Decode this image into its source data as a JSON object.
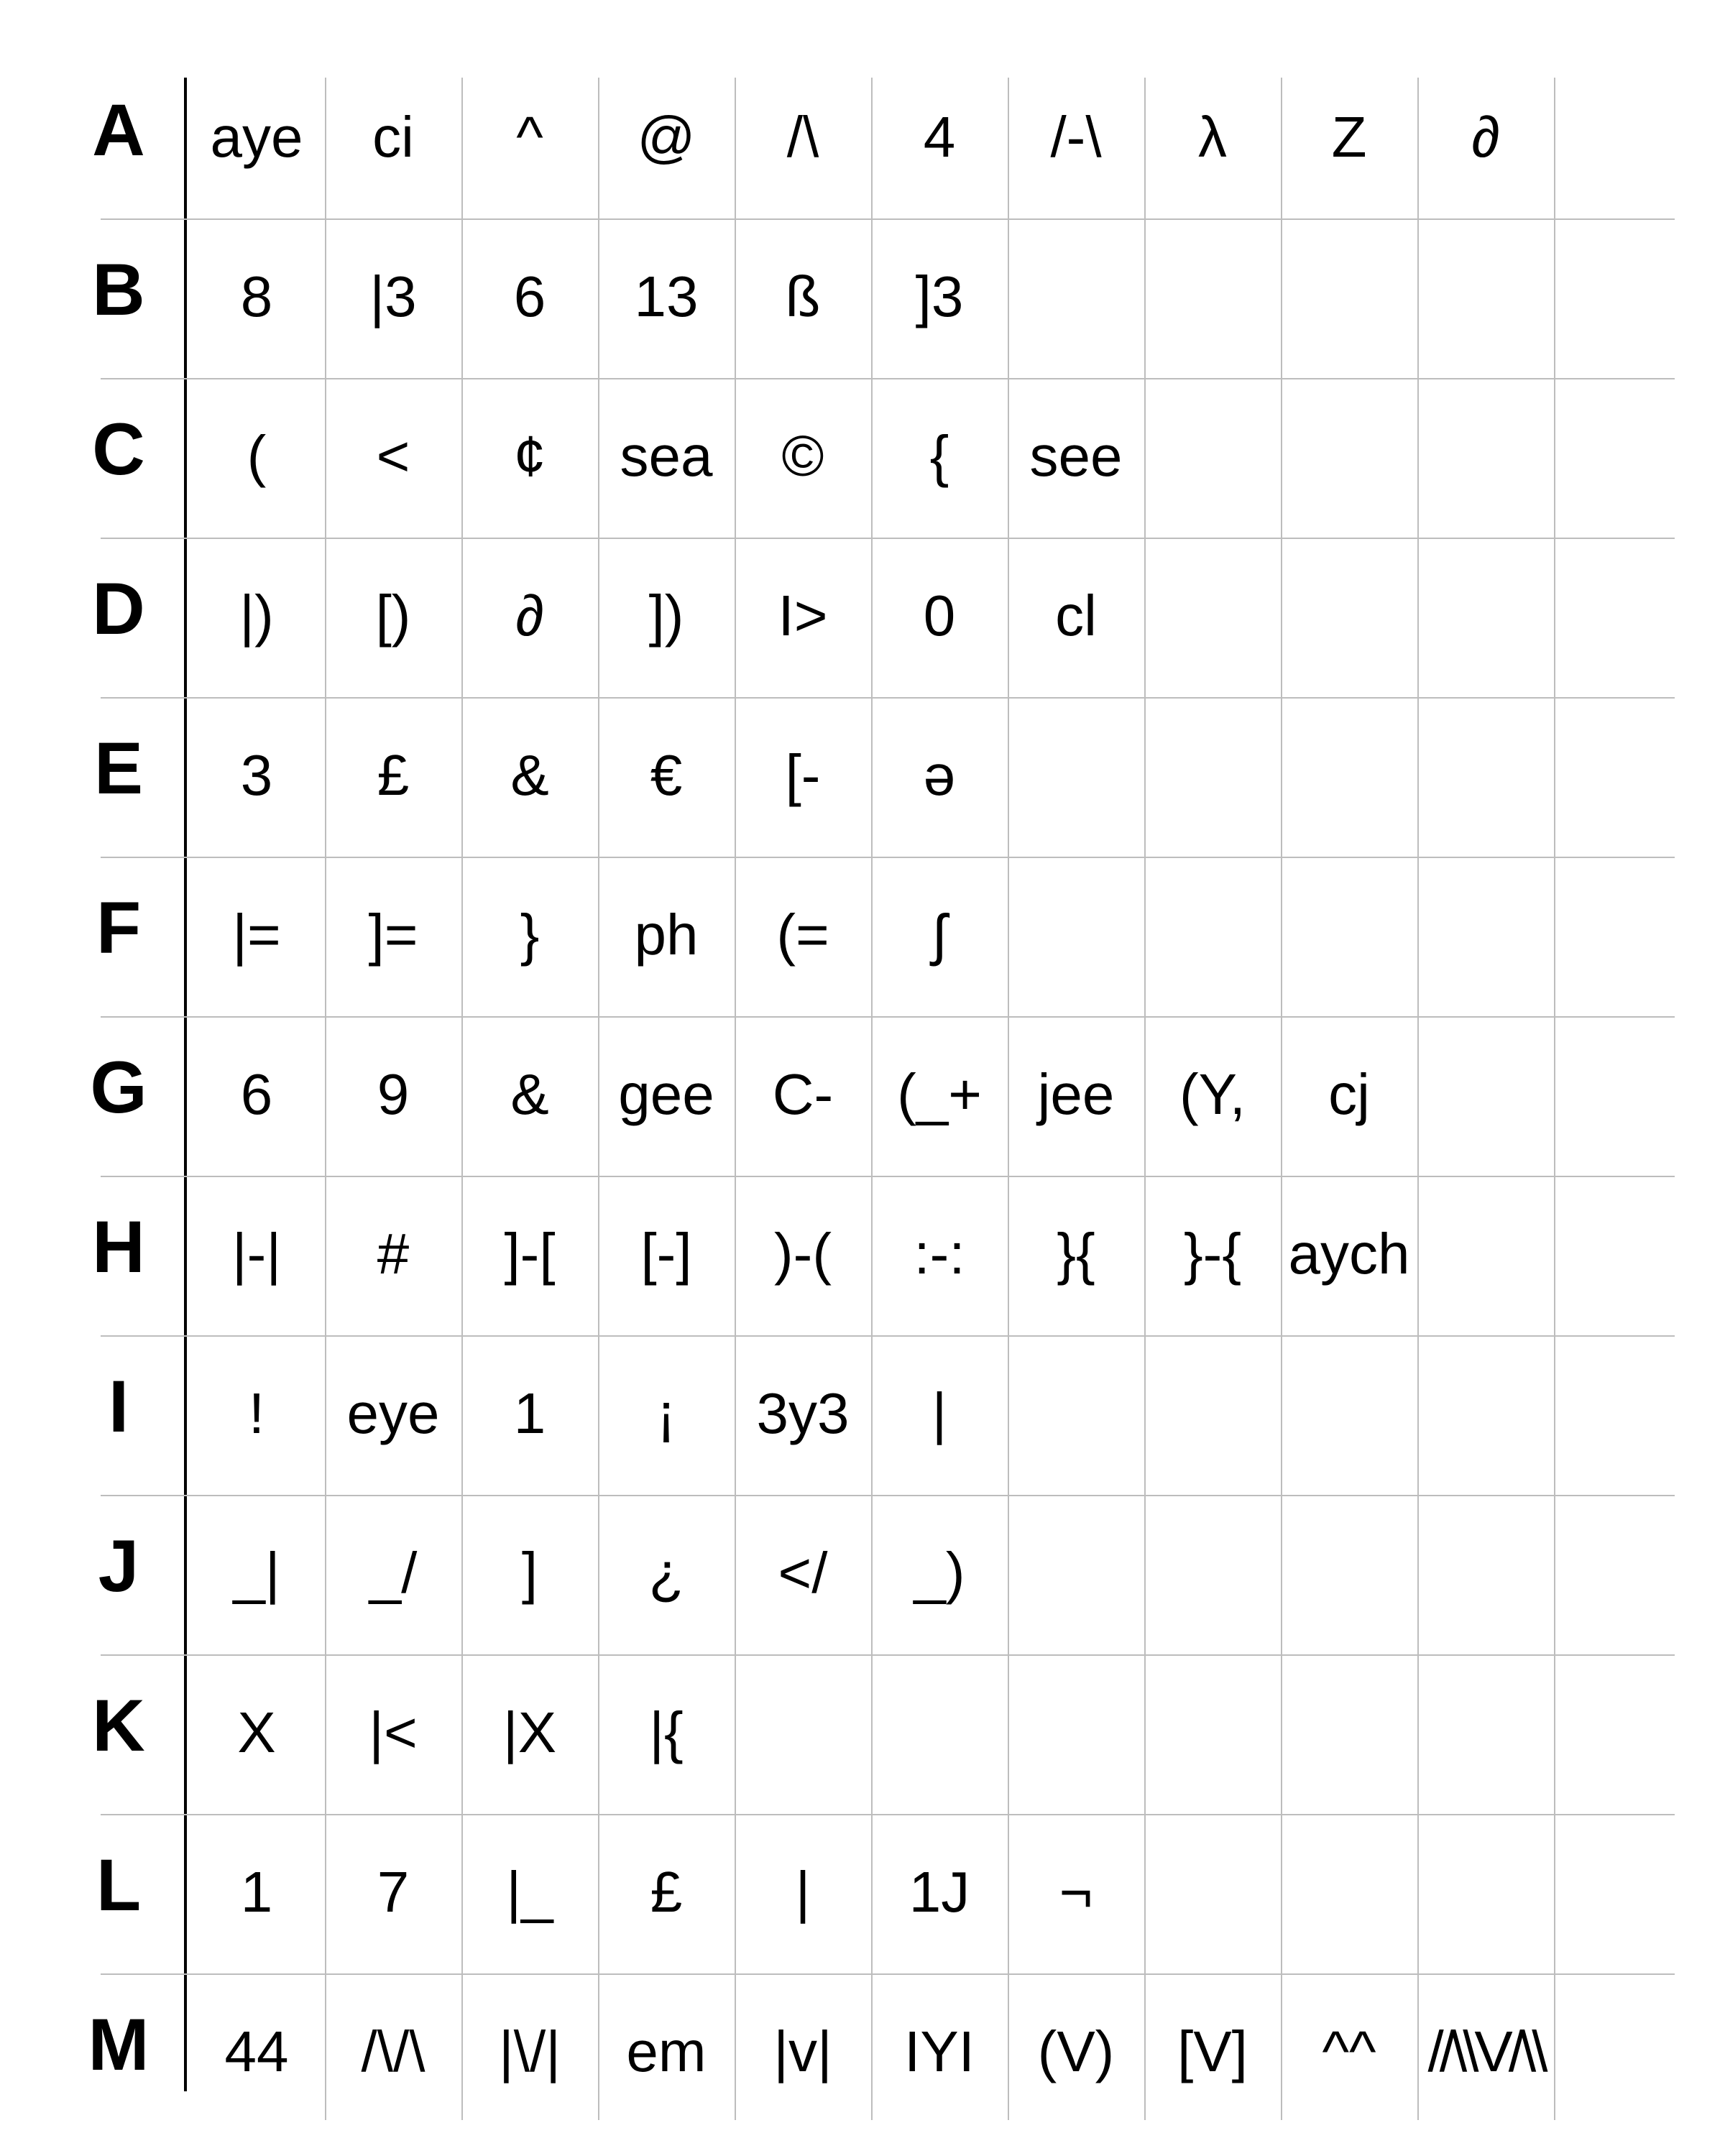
{
  "rows": [
    {
      "letter": "A",
      "entries": [
        "aye",
        "ci",
        "^",
        "@",
        "/\\",
        "4",
        "/-\\",
        "λ",
        "Z",
        "∂"
      ]
    },
    {
      "letter": "B",
      "entries": [
        "8",
        "|3",
        "6",
        "13",
        "ß",
        "]3"
      ]
    },
    {
      "letter": "C",
      "entries": [
        "(",
        "<",
        "¢",
        "sea",
        "©",
        "{",
        "see"
      ]
    },
    {
      "letter": "D",
      "entries": [
        "|)",
        "[)",
        "∂",
        "])",
        "I>",
        "0",
        "cl"
      ]
    },
    {
      "letter": "E",
      "entries": [
        "3",
        "£",
        "&",
        "€",
        "[-",
        "ə"
      ]
    },
    {
      "letter": "F",
      "entries": [
        "|=",
        "]=",
        "}",
        "ph",
        "(=",
        "ʃ"
      ]
    },
    {
      "letter": "G",
      "entries": [
        "6",
        "9",
        "&",
        "gee",
        "C-",
        "(_+",
        "jee",
        "(Y,",
        "cj"
      ]
    },
    {
      "letter": "H",
      "entries": [
        "|-|",
        "#",
        "]-[",
        "[-]",
        ")-(",
        ":-:",
        "}{",
        "}-{",
        "aych"
      ]
    },
    {
      "letter": "I",
      "entries": [
        "!",
        "eye",
        "1",
        "¡",
        "3y3",
        "|"
      ]
    },
    {
      "letter": "J",
      "entries": [
        "_|",
        "_/",
        "]",
        "¿",
        "</",
        "_)"
      ]
    },
    {
      "letter": "K",
      "entries": [
        "X",
        "|<",
        "|X",
        "|{"
      ]
    },
    {
      "letter": "L",
      "entries": [
        "1",
        "7",
        "|_",
        "£",
        "|",
        "1J",
        "¬"
      ]
    },
    {
      "letter": "M",
      "entries": [
        "44",
        "/\\/\\",
        "|\\/|",
        "em",
        "|v|",
        "IYI",
        "(V)",
        "[V]",
        "^^",
        "//\\\\V/\\\\"
      ]
    }
  ]
}
